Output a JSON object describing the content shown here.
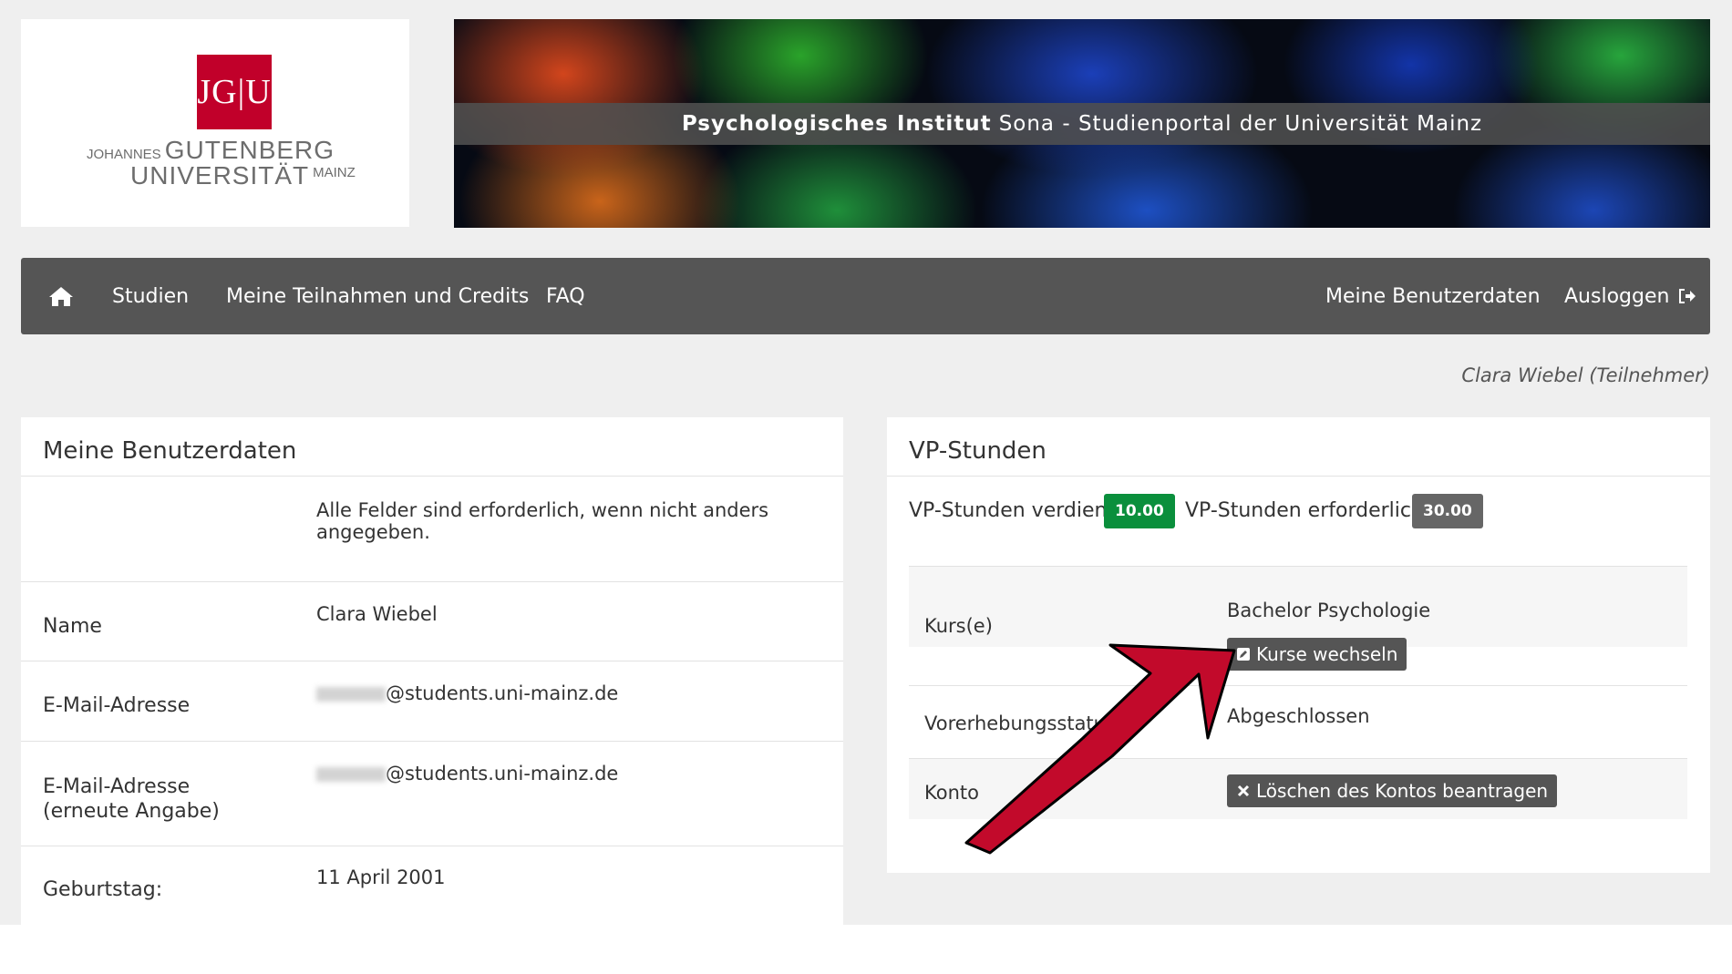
{
  "header": {
    "logo_mark": "JG|U",
    "logo_line1_small": "JOHANNES",
    "logo_line1": "GUTENBERG",
    "logo_line2": "UNIVERSITÄT",
    "logo_line2_small": "MAINZ",
    "banner_title_bold": "Psychologisches Institut",
    "banner_title_rest": "Sona - Studienportal der Universität Mainz"
  },
  "navbar": {
    "home_icon": "home-icon",
    "items": [
      {
        "label": "Studien"
      },
      {
        "label": "Meine Teilnahmen und Credits"
      },
      {
        "label": "FAQ"
      }
    ],
    "right_items": [
      {
        "label": "Meine Benutzerdaten"
      },
      {
        "label": "Ausloggen"
      }
    ],
    "logout_icon": "sign-out-icon"
  },
  "user_line": "Clara Wiebel (Teilnehmer)",
  "profile_panel": {
    "title": "Meine Benutzerdaten",
    "note": "Alle Felder sind erforderlich, wenn nicht anders angegeben.",
    "rows": [
      {
        "label": "Name",
        "value": "Clara Wiebel"
      },
      {
        "label": "E-Mail-Adresse",
        "value": "@students.uni-mainz.de"
      },
      {
        "label": "E-Mail-Adresse (erneute Angabe)",
        "value": "@students.uni-mainz.de"
      },
      {
        "label": "Geburtstag:",
        "value": "11 April 2001"
      }
    ]
  },
  "credits_panel": {
    "title": "VP-Stunden",
    "earned_label": "VP-Stunden verdient:",
    "earned_value": "10.00",
    "required_label": "VP-Stunden erforderlich:",
    "required_value": "30.00",
    "colors": {
      "earned": "#0a8f3c",
      "required": "#666666",
      "arrow": "#c20a2b"
    },
    "rows": [
      {
        "label": "Kurs(e)",
        "value": "Bachelor Psychologie",
        "button": "Kurse wechseln",
        "button_icon": "edit-icon"
      },
      {
        "label": "Vorerhebungsstatus",
        "value": "Abgeschlossen"
      },
      {
        "label": "Konto",
        "button": "Löschen des Kontos beantragen",
        "button_icon": "times-icon"
      }
    ]
  }
}
